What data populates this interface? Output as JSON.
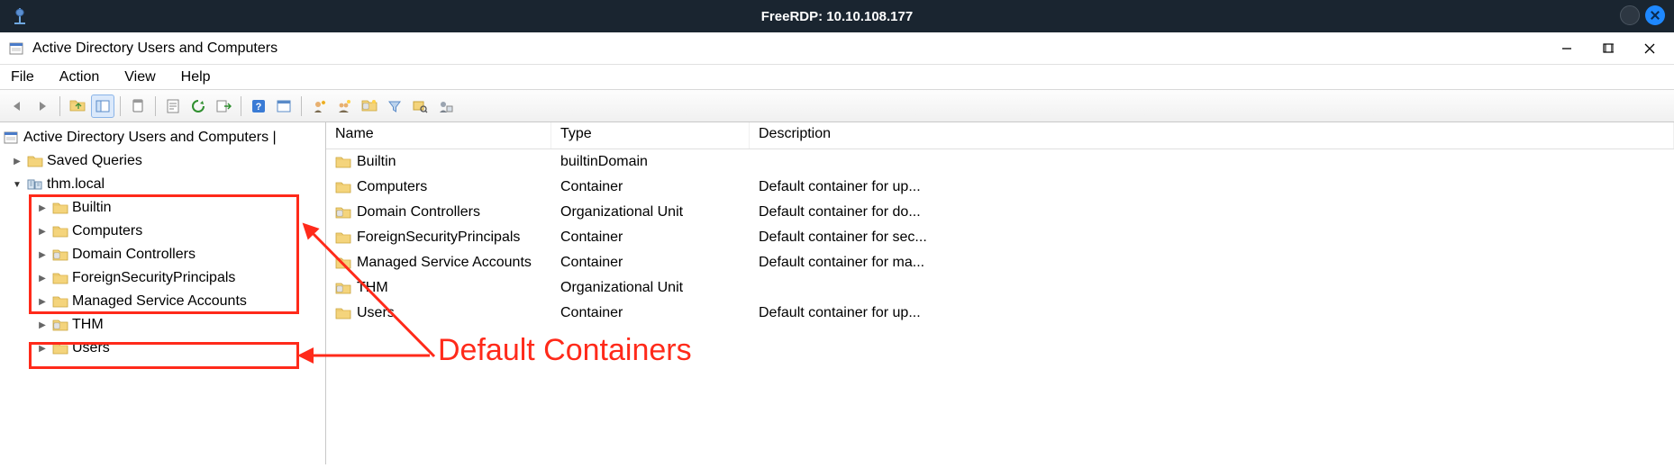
{
  "outer": {
    "title": "FreeRDP: 10.10.108.177"
  },
  "window": {
    "title": "Active Directory Users and Computers"
  },
  "menu": {
    "file": "File",
    "action": "Action",
    "view": "View",
    "help": "Help"
  },
  "tree": {
    "rootLabel": "Active Directory Users and Computers |",
    "savedQueries": "Saved Queries",
    "domain": "thm.local",
    "children": {
      "builtin": "Builtin",
      "computers": "Computers",
      "domainControllers": "Domain Controllers",
      "fsp": "ForeignSecurityPrincipals",
      "msa": "Managed Service Accounts",
      "thm": "THM",
      "users": "Users"
    }
  },
  "listHeader": {
    "name": "Name",
    "type": "Type",
    "description": "Description"
  },
  "list": [
    {
      "name": "Builtin",
      "type": "builtinDomain",
      "desc": "",
      "icon": "folder"
    },
    {
      "name": "Computers",
      "type": "Container",
      "desc": "Default container for up...",
      "icon": "folder"
    },
    {
      "name": "Domain Controllers",
      "type": "Organizational Unit",
      "desc": "Default container for do...",
      "icon": "ou"
    },
    {
      "name": "ForeignSecurityPrincipals",
      "type": "Container",
      "desc": "Default container for sec...",
      "icon": "folder"
    },
    {
      "name": "Managed Service Accounts",
      "type": "Container",
      "desc": "Default container for ma...",
      "icon": "folder"
    },
    {
      "name": "THM",
      "type": "Organizational Unit",
      "desc": "",
      "icon": "ou"
    },
    {
      "name": "Users",
      "type": "Container",
      "desc": "Default container for up...",
      "icon": "folder"
    }
  ],
  "annotation": {
    "label": "Default Containers"
  }
}
